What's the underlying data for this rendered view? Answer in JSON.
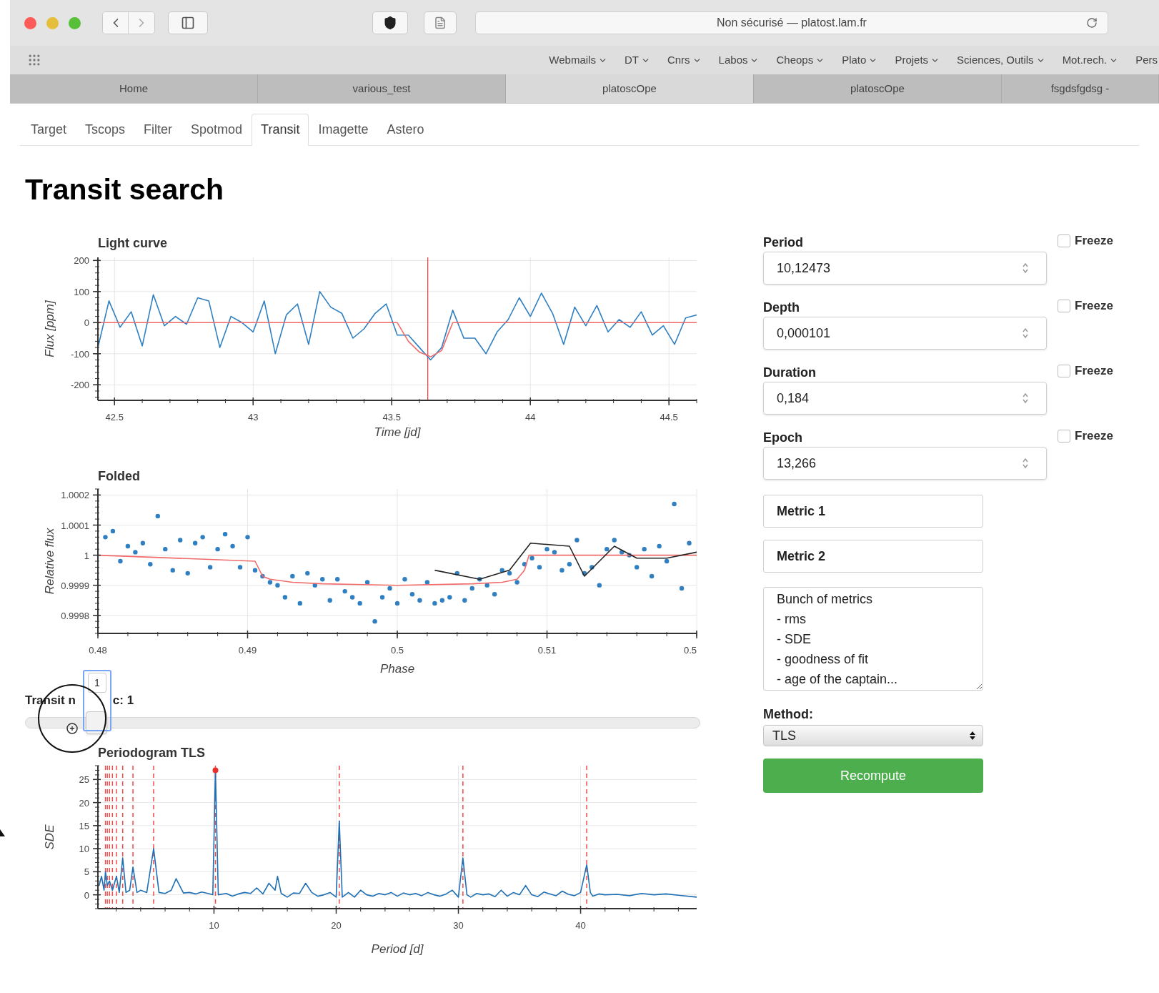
{
  "browser": {
    "address": "Non sécurisé — platost.lam.fr",
    "bookmarks": [
      {
        "label": "Webmails",
        "menu": true
      },
      {
        "label": "DT",
        "menu": true
      },
      {
        "label": "Cnrs",
        "menu": true
      },
      {
        "label": "Labos",
        "menu": true
      },
      {
        "label": "Cheops",
        "menu": true
      },
      {
        "label": "Plato",
        "menu": true
      },
      {
        "label": "Projets",
        "menu": true
      },
      {
        "label": "Sciences, Outils",
        "menu": true
      },
      {
        "label": "Mot.rech.",
        "menu": true
      },
      {
        "label": "Pers",
        "menu": false
      }
    ],
    "tabs": [
      {
        "label": "Home",
        "selected": false
      },
      {
        "label": "various_test",
        "selected": false
      },
      {
        "label": "platoscOpe",
        "selected": true
      },
      {
        "label": "platoscOpe",
        "selected": false
      },
      {
        "label": "fsgdsfgdsg -",
        "selected": false
      }
    ]
  },
  "nav_tabs": [
    {
      "label": "Target",
      "selected": false
    },
    {
      "label": "Tscops",
      "selected": false
    },
    {
      "label": "Filter",
      "selected": false
    },
    {
      "label": "Spotmod",
      "selected": false
    },
    {
      "label": "Transit",
      "selected": true
    },
    {
      "label": "Imagette",
      "selected": false
    },
    {
      "label": "Astero",
      "selected": false
    }
  ],
  "heading": "Transit search",
  "light_curve": {
    "chart_data": {
      "type": "line",
      "title": "Light curve",
      "xlabel": "Time [jd]",
      "ylabel": "Flux [ppm]",
      "x": [
        42.44,
        42.48,
        42.52,
        42.56,
        42.6,
        42.64,
        42.68,
        42.72,
        42.76,
        42.8,
        42.84,
        42.88,
        42.92,
        42.96,
        43,
        43.04,
        43.08,
        43.12,
        43.16,
        43.2,
        43.24,
        43.28,
        43.32,
        43.36,
        43.4,
        43.44,
        43.48,
        43.52,
        43.56,
        43.6,
        43.64,
        43.68,
        43.72,
        43.76,
        43.8,
        43.84,
        43.88,
        43.92,
        43.96,
        44,
        44.04,
        44.08,
        44.12,
        44.16,
        44.2,
        44.24,
        44.28,
        44.32,
        44.36,
        44.4,
        44.44,
        44.48,
        44.52,
        44.56,
        44.6
      ],
      "series": [
        {
          "color": "#2f7fc1",
          "values": [
            -80,
            70,
            -15,
            35,
            -75,
            90,
            -10,
            20,
            -5,
            80,
            70,
            -80,
            20,
            0,
            -30,
            70,
            -100,
            25,
            60,
            -70,
            100,
            50,
            30,
            -50,
            -20,
            30,
            60,
            -40,
            -40,
            -80,
            -120,
            -80,
            40,
            -50,
            -50,
            -100,
            -30,
            10,
            80,
            20,
            95,
            30,
            -70,
            50,
            -10,
            55,
            -30,
            10,
            -15,
            35,
            -40,
            -10,
            -70,
            15,
            25
          ]
        },
        {
          "color": "#f26b6b",
          "values": [
            0,
            0,
            0,
            0,
            0,
            0,
            0,
            0,
            0,
            0,
            0,
            0,
            0,
            0,
            0,
            0,
            0,
            0,
            0,
            0,
            0,
            0,
            0,
            0,
            0,
            0,
            0,
            0,
            -60,
            -95,
            -110,
            -90,
            0,
            0,
            0,
            0,
            0,
            0,
            0,
            0,
            0,
            0,
            0,
            0,
            0,
            0,
            0,
            0,
            0,
            0,
            0,
            0,
            0,
            0,
            0
          ]
        }
      ],
      "xlim": [
        42.44,
        44.6
      ],
      "ylim": [
        -250,
        210
      ],
      "xticks": [
        42.5,
        43,
        43.5,
        44,
        44.5
      ],
      "yticks": [
        -200,
        -100,
        0,
        100,
        200
      ],
      "grid": true,
      "ref_lines": [
        {
          "axis": "x",
          "value": 43.63
        }
      ]
    }
  },
  "folded": {
    "chart_data": {
      "type": "scatter",
      "title": "Folded",
      "xlabel": "Phase",
      "ylabel": "Relative flux",
      "series": [
        {
          "color": "#2f7fc1",
          "x": [
            0.4805,
            0.481,
            0.4815,
            0.482,
            0.4825,
            0.483,
            0.4835,
            0.484,
            0.4845,
            0.485,
            0.4855,
            0.486,
            0.4865,
            0.487,
            0.4875,
            0.488,
            0.4885,
            0.489,
            0.4895,
            0.49,
            0.4905,
            0.491,
            0.4915,
            0.492,
            0.4925,
            0.493,
            0.4935,
            0.494,
            0.4945,
            0.495,
            0.4955,
            0.496,
            0.4965,
            0.497,
            0.4975,
            0.498,
            0.4985,
            0.499,
            0.4995,
            0.5,
            0.5005,
            0.501,
            0.5015,
            0.502,
            0.5025,
            0.503,
            0.5035,
            0.504,
            0.5045,
            0.505,
            0.5055,
            0.506,
            0.5065,
            0.507,
            0.5075,
            0.508,
            0.5085,
            0.509,
            0.5095,
            0.51,
            0.5105,
            0.511,
            0.5115,
            0.512,
            0.5125,
            0.513,
            0.5135,
            0.514,
            0.5145,
            0.515,
            0.5155,
            0.516,
            0.5165,
            0.517,
            0.5175,
            0.518,
            0.5185,
            0.519,
            0.5195
          ],
          "values": [
            1.00006,
            1.00008,
            0.99998,
            1.00003,
            1.00001,
            1.00004,
            0.99997,
            1.00013,
            1.00002,
            0.99995,
            1.00005,
            0.99994,
            1.00004,
            1.00006,
            0.99996,
            1.00002,
            1.00007,
            1.00003,
            0.99996,
            1.00006,
            0.99995,
            0.99993,
            0.99991,
            0.9999,
            0.99986,
            0.99993,
            0.99984,
            0.99994,
            0.9999,
            0.99992,
            0.99985,
            0.99992,
            0.99988,
            0.99986,
            0.99984,
            0.99991,
            0.99978,
            0.99986,
            0.99989,
            0.99984,
            0.99992,
            0.99987,
            0.99985,
            0.99991,
            0.99984,
            0.99985,
            0.99986,
            0.99994,
            0.99985,
            0.99989,
            0.99992,
            0.9999,
            0.99987,
            0.99995,
            0.99994,
            0.99991,
            0.99997,
            0.99999,
            0.99996,
            1.00002,
            1.00001,
            0.99995,
            0.99997,
            1.00005,
            0.99994,
            0.99996,
            0.9999,
            1.00002,
            1.00005,
            1.00001,
            1,
            0.99996,
            1.00002,
            0.99993,
            1.00003,
            0.99998,
            1.00017,
            0.99989,
            1.00004
          ]
        },
        {
          "type": "line",
          "color": "#f26b6b",
          "x": [
            0.48,
            0.4905,
            0.491,
            0.4915,
            0.493,
            0.495,
            0.5,
            0.505,
            0.507,
            0.508,
            0.5085,
            0.5088,
            0.52
          ],
          "values": [
            1,
            0.99998,
            0.99993,
            0.99992,
            0.99991,
            0.999905,
            0.9999,
            0.999905,
            0.99991,
            0.99992,
            0.99995,
            1,
            1
          ]
        },
        {
          "type": "line",
          "color": "#222222",
          "x": [
            0.5025,
            0.5055,
            0.5075,
            0.5089,
            0.5115,
            0.5125,
            0.5145,
            0.516,
            0.518,
            0.52
          ],
          "values": [
            0.99995,
            0.99992,
            0.99995,
            1.00004,
            1.00003,
            0.99993,
            1.00003,
            0.99999,
            0.99999,
            1.00001
          ]
        }
      ],
      "xlim": [
        0.48,
        0.52
      ],
      "ylim": [
        0.99974,
        1.00022
      ],
      "xticks": [
        0.48,
        0.49,
        0.5,
        0.51,
        {
          "value": 0.52,
          "label": "0.5"
        }
      ],
      "yticks": [
        0.9998,
        0.9999,
        1,
        1.0001,
        1.0002
      ],
      "grid": true
    }
  },
  "transit_slider": {
    "label_start": "Transit n",
    "label_end": "c: 1",
    "tooltip": "1",
    "level": 0.09
  },
  "periodogram": {
    "chart_data": {
      "type": "line",
      "title": "Periodogram TLS",
      "xlabel": "Period [d]",
      "ylabel": "SDE",
      "x": [
        0.6,
        0.8,
        1,
        1.12,
        1.27,
        1.45,
        1.69,
        2.02,
        2.25,
        2.53,
        2.8,
        3.1,
        3.37,
        3.7,
        4,
        4.5,
        5.06,
        5.5,
        6,
        6.5,
        6.9,
        7.5,
        8,
        8.5,
        9,
        9.5,
        9.9,
        10.12,
        10.35,
        11,
        11.5,
        12,
        12.5,
        13,
        13.5,
        14,
        14.5,
        15,
        15.2,
        15.5,
        16,
        16.5,
        17,
        17.5,
        18,
        18.5,
        19,
        19.5,
        20,
        20.25,
        20.5,
        21,
        21.5,
        22,
        22.5,
        23,
        23.5,
        24,
        24.5,
        25,
        25.5,
        26,
        26.5,
        27,
        27.5,
        28,
        28.5,
        29,
        29.5,
        30,
        30.37,
        30.7,
        31,
        31.5,
        32,
        32.5,
        33,
        33.5,
        34,
        34.5,
        35,
        35.5,
        36,
        36.5,
        37,
        37.5,
        38,
        38.5,
        39,
        39.5,
        40,
        40.5,
        40.8,
        41,
        41.5,
        42,
        43,
        44,
        45,
        46,
        47,
        48,
        49.5
      ],
      "series": [
        {
          "color": "#1f6fb4",
          "values": [
            2,
            4,
            1,
            5,
            2,
            3,
            1,
            4,
            0.5,
            8,
            0.5,
            1,
            6,
            0.5,
            1,
            0.5,
            10,
            0.5,
            0.3,
            1,
            3.5,
            0.4,
            0.5,
            0.2,
            0.6,
            0.3,
            0,
            27,
            0,
            0.3,
            -0.3,
            0.2,
            0.5,
            0.3,
            1.5,
            0.2,
            2.5,
            1,
            4,
            0.3,
            -0.5,
            0.4,
            0.3,
            2.5,
            0.5,
            -0.3,
            0,
            0.5,
            -0.5,
            16,
            -0.5,
            0.5,
            -0.5,
            1,
            0,
            -0.3,
            0.3,
            0,
            0.5,
            -0.3,
            0.4,
            0,
            0.3,
            -0.2,
            0.5,
            0,
            -0.3,
            0.2,
            1,
            -0.5,
            8,
            0,
            -0.5,
            0.3,
            0,
            0.2,
            -0.4,
            1,
            -0.3,
            0.5,
            0,
            2,
            0,
            -0.4,
            0.6,
            0.2,
            -0.2,
            0.8,
            0.1,
            -0.2,
            0.5,
            6.5,
            0.5,
            -0.3,
            0.2,
            0,
            0.1,
            -0.2,
            0.3,
            0,
            0.2,
            -0.1,
            -0.5
          ]
        }
      ],
      "xlim": [
        0.5,
        49.5
      ],
      "ylim": [
        -3,
        28
      ],
      "xticks": [
        10,
        20,
        30,
        40
      ],
      "yticks": [
        0,
        5,
        10,
        15,
        20,
        25
      ],
      "grid": true,
      "ref_lines": [
        {
          "axis": "x",
          "value": 10.12
        },
        {
          "axis": "x",
          "value": 20.25
        },
        {
          "axis": "x",
          "value": 30.37
        },
        {
          "axis": "x",
          "value": 40.5
        },
        {
          "axis": "x",
          "value": 5.06
        },
        {
          "axis": "x",
          "value": 3.37
        },
        {
          "axis": "x",
          "value": 2.53
        },
        {
          "axis": "x",
          "value": 2.02
        },
        {
          "axis": "x",
          "value": 1.69
        },
        {
          "axis": "x",
          "value": 1.45
        },
        {
          "axis": "x",
          "value": 1.27
        },
        {
          "axis": "x",
          "value": 1.12
        }
      ]
    }
  },
  "parameters": [
    {
      "label": "Period",
      "value": "10,12473",
      "freeze_label": "Freeze",
      "checked": false
    },
    {
      "label": "Depth",
      "value": "0,000101",
      "freeze_label": "Freeze",
      "checked": false
    },
    {
      "label": "Duration",
      "value": "0,184",
      "freeze_label": "Freeze",
      "checked": false
    },
    {
      "label": "Epoch",
      "value": "13,266",
      "freeze_label": "Freeze",
      "checked": false
    }
  ],
  "metrics": [
    {
      "value": "Metric 1"
    },
    {
      "value": "Metric 2"
    }
  ],
  "notes": "Bunch of metrics\n- rms\n- SDE\n- goodness of fit\n- age of the captain...",
  "method": {
    "label": "Method:",
    "value": "TLS"
  },
  "recompute": "Recompute"
}
